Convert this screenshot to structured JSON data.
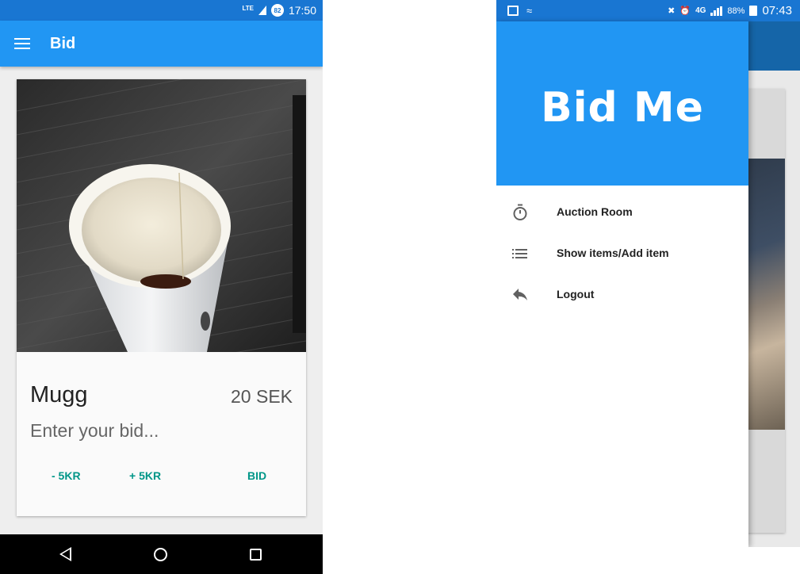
{
  "left_screen": {
    "status_bar": {
      "network": "LTE",
      "badge": "82",
      "time": "17:50"
    },
    "app_bar": {
      "menu_icon": "hamburger-menu-icon",
      "title": "Bid"
    },
    "card": {
      "image": "paper coffee cup on dark wooden table",
      "title": "Mugg",
      "price": "20 SEK",
      "bid_placeholder": "Enter your bid...",
      "buttons": {
        "minus": "- 5KR",
        "plus": "+ 5KR",
        "bid": "BID"
      },
      "accent_color": "#009688"
    },
    "nav_bar": {
      "back_icon": "back-triangle-icon",
      "home_icon": "home-circle-icon",
      "recents_icon": "recents-square-icon"
    }
  },
  "right_screen": {
    "status_bar": {
      "battery_percent": "88%",
      "network": "4G",
      "time": "07:43"
    },
    "drawer": {
      "logo": "Bid Me",
      "header_color": "#2196f3",
      "items": [
        {
          "icon": "timer-icon",
          "label": "Auction Room"
        },
        {
          "icon": "list-icon",
          "label": "Show items/Add item"
        },
        {
          "icon": "reply-arrow-icon",
          "label": "Logout"
        }
      ]
    }
  },
  "colors": {
    "primary": "#2196f3",
    "primary_dark": "#1976d2"
  }
}
